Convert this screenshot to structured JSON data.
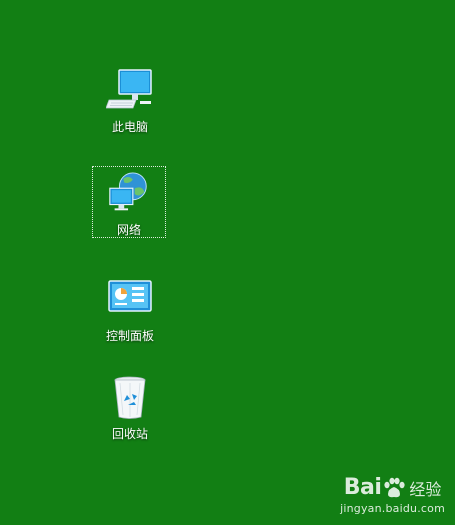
{
  "desktop": {
    "background_color": "#127f14",
    "icons": [
      {
        "label": "此电脑",
        "icon": "computer-icon",
        "selected": false
      },
      {
        "label": "网络",
        "icon": "network-icon",
        "selected": true
      },
      {
        "label": "控制面板",
        "icon": "control-panel-icon",
        "selected": false
      },
      {
        "label": "回收站",
        "icon": "recycle-bin-icon",
        "selected": false
      }
    ]
  },
  "watermark": {
    "brand": "Bai",
    "brand_icon": "paw-icon",
    "suffix": "经验",
    "url": "jingyan.baidu.com"
  }
}
